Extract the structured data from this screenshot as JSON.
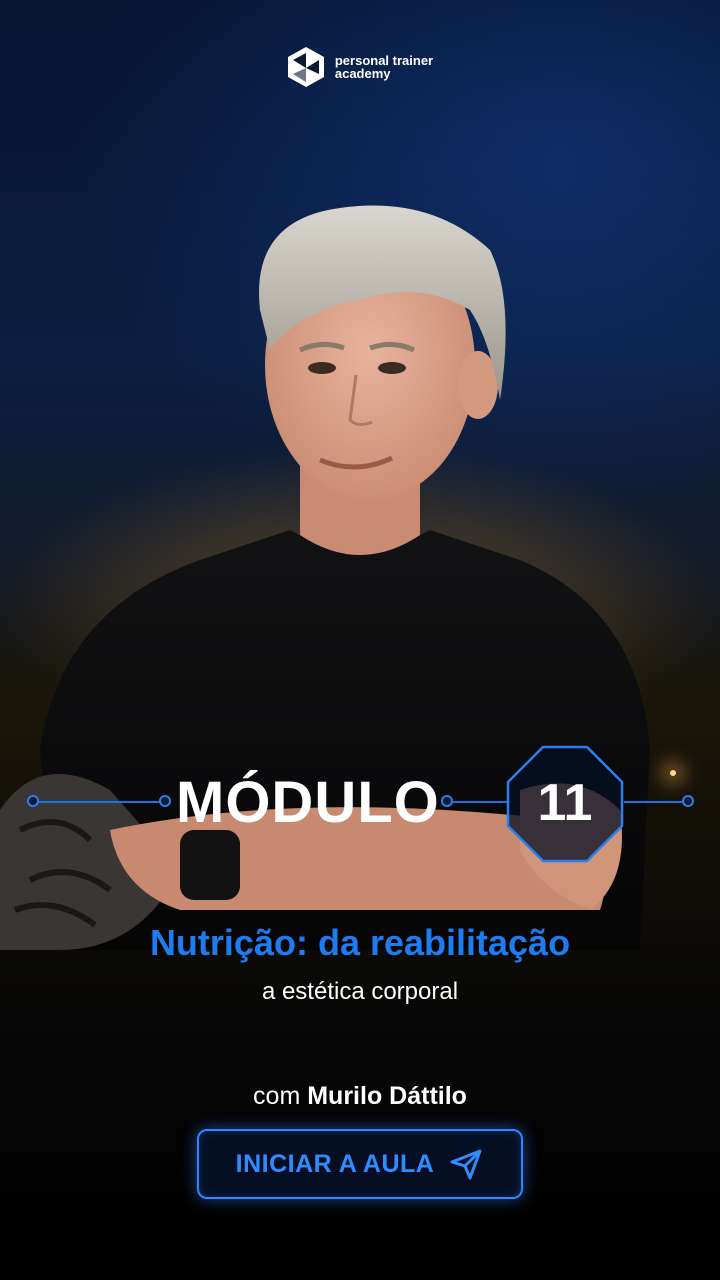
{
  "brand": {
    "line1": "personal trainer",
    "line2": "academy",
    "icon": "academy-logo-icon"
  },
  "module": {
    "label": "MÓDULO",
    "number": "11"
  },
  "course": {
    "title": "Nutrição: da reabilitação",
    "subtitle": "a estética corporal"
  },
  "instructor": {
    "prefix": "com",
    "name": "Murilo Dáttilo"
  },
  "cta": {
    "label": "INICIAR A AULA",
    "icon": "send-icon"
  },
  "colors": {
    "accent": "#1d7cf2",
    "background": "#000000"
  }
}
